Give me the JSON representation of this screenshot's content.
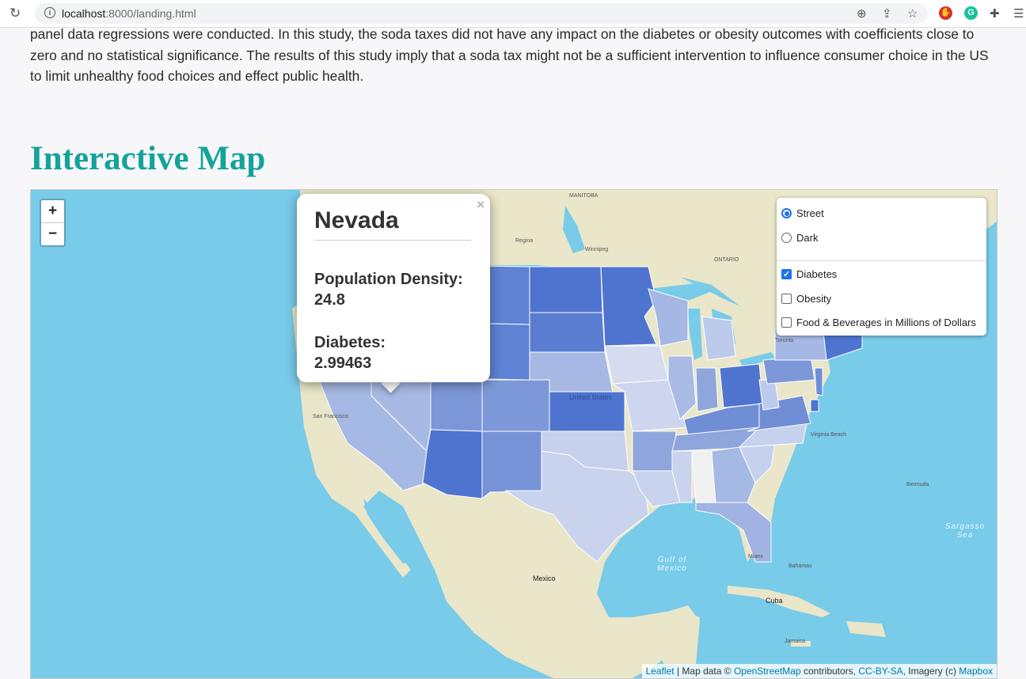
{
  "browser": {
    "url_host": "localhost",
    "url_rest": ":8000/landing.html"
  },
  "page": {
    "paragraph": "panel data regressions were conducted. In this study, the soda taxes did not have any impact on the diabetes or obesity outcomes with coefficients close to zero and no statistical significance. The results of this study imply that a soda tax might not be a sufficient intervention to influence consumer choice in the US to limit unhealthy food choices and effect public health.",
    "heading": "Interactive Map"
  },
  "map": {
    "zoom_in": "+",
    "zoom_out": "−",
    "popup": {
      "close": "×",
      "state": "Nevada",
      "density_label": "Population Density:",
      "density_value": "24.8",
      "metric_label": "Diabetes:",
      "metric_value": "2.99463"
    },
    "layers": {
      "base": [
        {
          "label": "Street",
          "selected": true
        },
        {
          "label": "Dark",
          "selected": false
        }
      ],
      "overlays": [
        {
          "label": "Diabetes",
          "checked": true
        },
        {
          "label": "Obesity",
          "checked": false
        },
        {
          "label": "Food & Beverages in Millions of Dollars",
          "checked": false
        }
      ]
    },
    "attribution": {
      "leaflet": "Leaflet",
      "map_data": " | Map data © ",
      "osm": "OpenStreetMap",
      "contributors": " contributors, ",
      "license": "CC-BY-SA",
      "imagery": ", Imagery (c) ",
      "mapbox": "Mapbox"
    },
    "labels": {
      "mexico": "Mexico",
      "cuba": "Cuba",
      "bermuda": "Bermuda",
      "bahamas": "Bahamas",
      "united_states": "United States",
      "gulf": "Gulf of Mexico",
      "sargasso": "Sargasso Sea",
      "san_francisco": "San Francisco",
      "virginia_beach": "Virginia Beach",
      "toronto": "Toronto",
      "winnipeg": "Winnipeg",
      "regina": "Regina",
      "ontario": "ONTARIO",
      "manitoba": "MANITOBA",
      "miami": "Miami",
      "jamaica": "Jamaica"
    }
  },
  "colors": {
    "accent": "#14a39a",
    "ocean": "#78cbe9",
    "land": "#e9e6c9"
  }
}
